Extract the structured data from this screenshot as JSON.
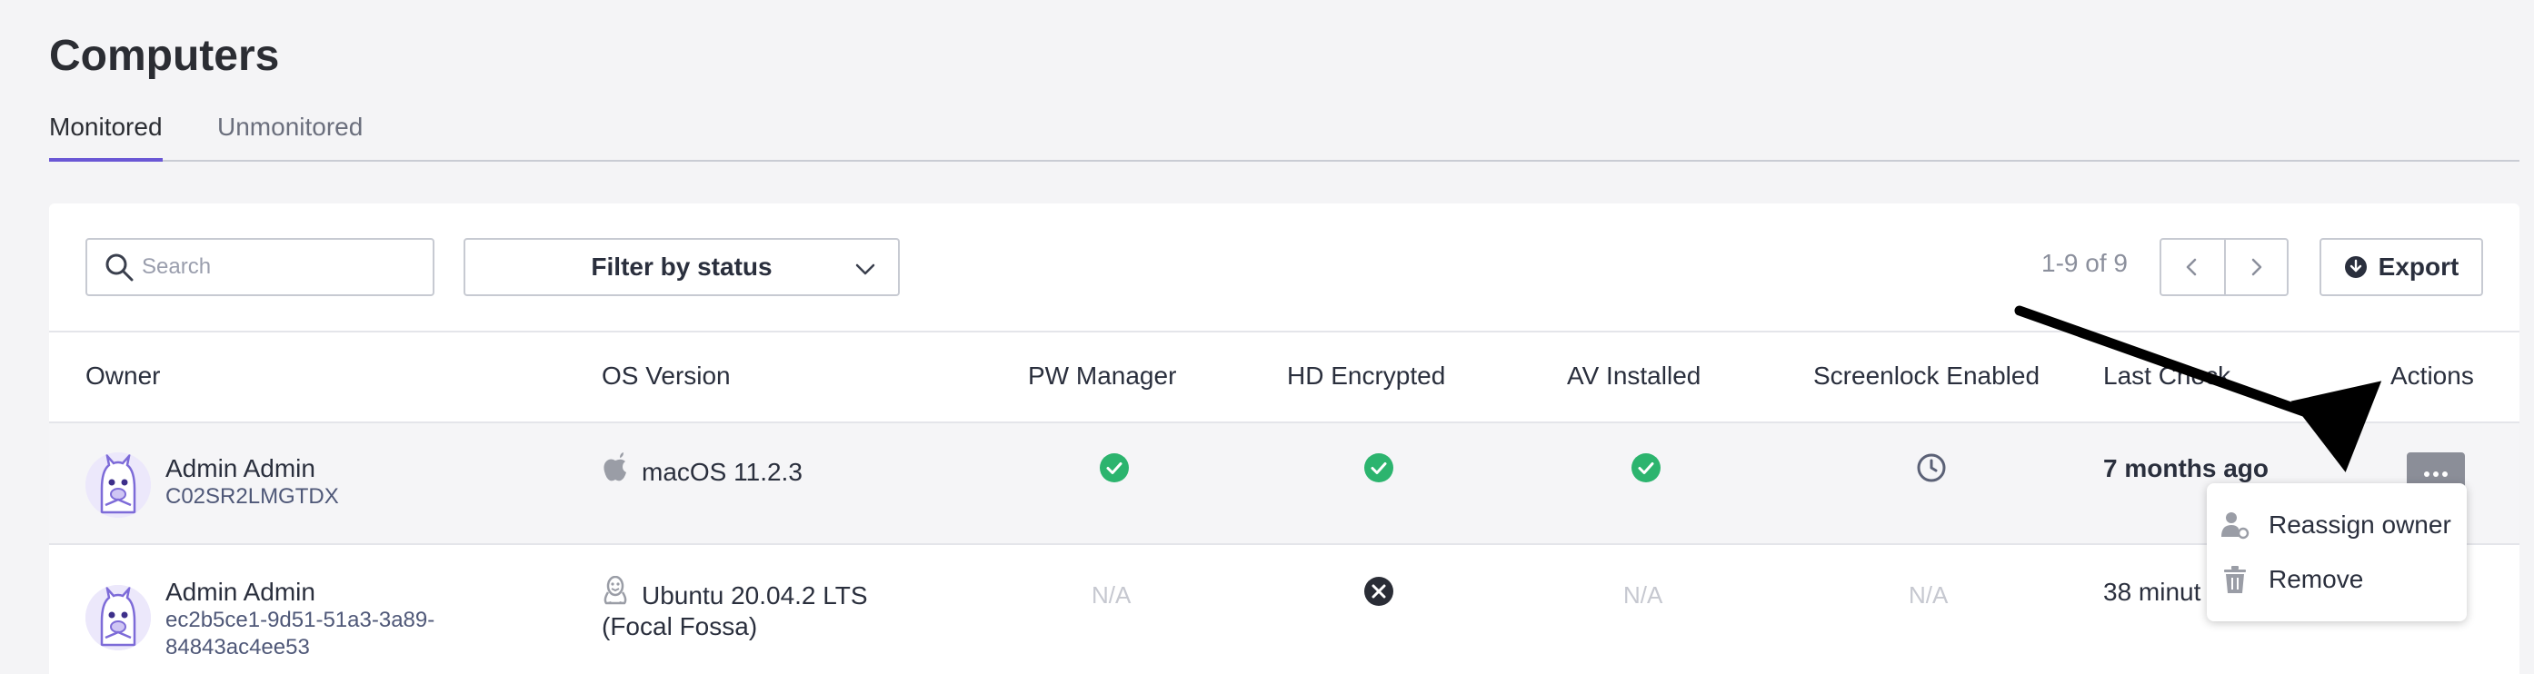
{
  "page": {
    "title": "Computers"
  },
  "tabs": [
    {
      "label": "Monitored",
      "active": true
    },
    {
      "label": "Unmonitored",
      "active": false
    }
  ],
  "toolbar": {
    "search_placeholder": "Search",
    "filter_label": "Filter by status",
    "pagination": "1-9 of 9",
    "export_label": "Export"
  },
  "table": {
    "columns": [
      "Owner",
      "OS Version",
      "PW Manager",
      "HD Encrypted",
      "AV Installed",
      "Screenlock Enabled",
      "Last Check",
      "Actions"
    ],
    "rows": [
      {
        "owner": "Admin Admin",
        "serial": "C02SR2LMGTDX",
        "os_icon": "apple-icon",
        "os_line1": "macOS 11.2.3",
        "os_line2": "",
        "pw_manager": "check",
        "hd_encrypted": "check",
        "av_installed": "check",
        "screenlock": "clock",
        "last_check": "7 months ago"
      },
      {
        "owner": "Admin Admin",
        "serial_line1": "ec2b5ce1-9d51-51a3-3a89-",
        "serial_line2": "84843ac4ee53",
        "os_icon": "linux-icon",
        "os_line1": "Ubuntu 20.04.2 LTS",
        "os_line2": "(Focal Fossa)",
        "pw_manager": "N/A",
        "hd_encrypted": "x",
        "av_installed": "N/A",
        "screenlock": "N/A",
        "last_check": "38 minut"
      }
    ]
  },
  "action_menu": {
    "items": [
      {
        "label": "Reassign owner",
        "icon": "user-reassign-icon"
      },
      {
        "label": "Remove",
        "icon": "trash-icon"
      }
    ]
  },
  "colors": {
    "accent": "#6a57d5",
    "success": "#2cb46e",
    "neutral_button": "#8b8e98",
    "arrow": "#000000"
  }
}
